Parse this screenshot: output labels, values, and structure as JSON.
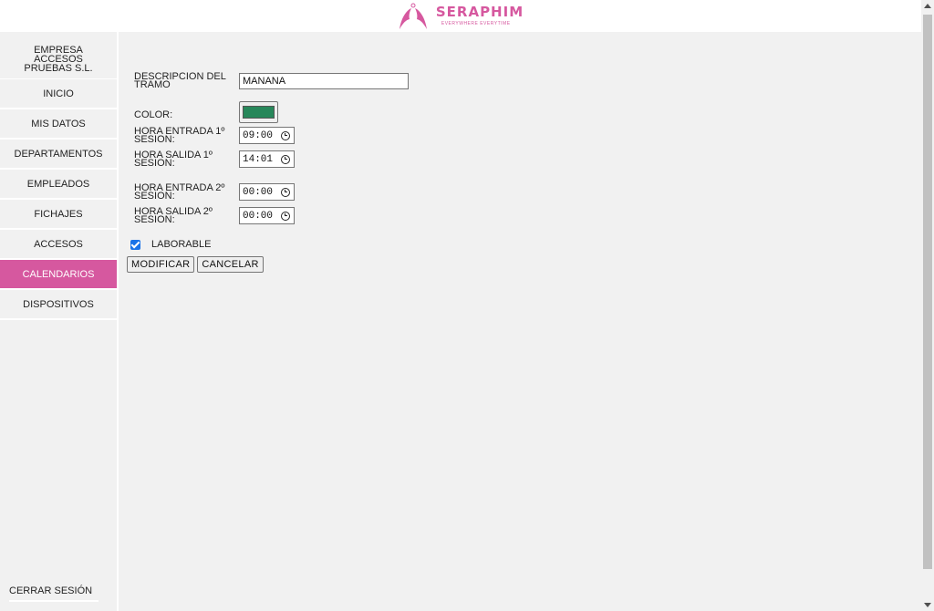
{
  "header": {
    "brand": "SERAPHIM",
    "tagline": "EVERYWHERE EVERYTIME",
    "brand_color": "#d6589f"
  },
  "sidebar": {
    "company": "EMPRESA ACCESOS PRUEBAS S.L.",
    "items": [
      {
        "label": "INICIO",
        "active": false
      },
      {
        "label": "MIS DATOS",
        "active": false
      },
      {
        "label": "DEPARTAMENTOS",
        "active": false
      },
      {
        "label": "EMPLEADOS",
        "active": false
      },
      {
        "label": "FICHAJES",
        "active": false
      },
      {
        "label": "ACCESOS",
        "active": false
      },
      {
        "label": "CALENDARIOS",
        "active": true
      },
      {
        "label": "DISPOSITIVOS",
        "active": false
      }
    ],
    "logout": "CERRAR SESIÓN"
  },
  "form": {
    "description_label": "DESCRIPCION DEL TRAMO",
    "description_value": "MANANA",
    "color_label": "COLOR:",
    "color_value": "#27875a",
    "entry1_label": "HORA ENTRADA 1º SESION:",
    "entry1_value": "09:00",
    "exit1_label": "HORA SALIDA 1º SESION:",
    "exit1_value": "14:01",
    "entry2_label": "HORA ENTRADA 2º SESION:",
    "entry2_value": "00:00",
    "exit2_label": "HORA SALIDA 2º SESION:",
    "exit2_value": "00:00",
    "working_label": "LABORABLE",
    "working_checked": true,
    "modify_label": "MODIFICAR",
    "cancel_label": "CANCELAR"
  }
}
